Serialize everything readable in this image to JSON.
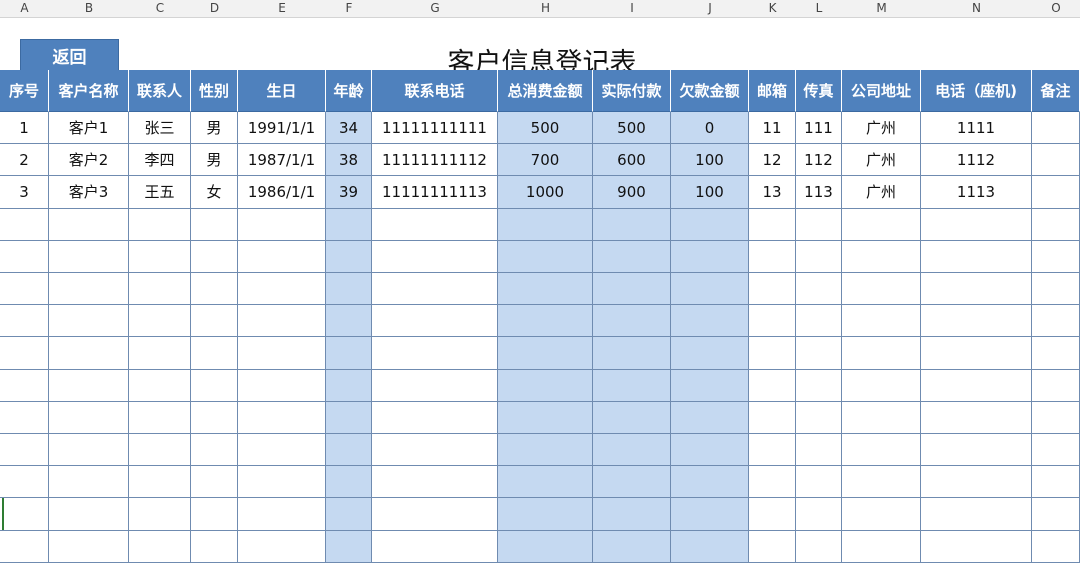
{
  "column_letters": [
    "A",
    "B",
    "C",
    "D",
    "E",
    "F",
    "G",
    "H",
    "I",
    "J",
    "K",
    "L",
    "M",
    "N",
    "O"
  ],
  "back_button": "返回",
  "title": "客户信息登记表",
  "headers": [
    "序号",
    "客户名称",
    "联系人",
    "性别",
    "生日",
    "年龄",
    "联系电话",
    "总消费金额",
    "实际付款",
    "欠款金额",
    "邮箱",
    "传真",
    "公司地址",
    "电话（座机)",
    "备注"
  ],
  "rows": [
    [
      "1",
      "客户1",
      "张三",
      "男",
      "1991/1/1",
      "34",
      "11111111111",
      "500",
      "500",
      "0",
      "11",
      "111",
      "广州",
      "1111",
      ""
    ],
    [
      "2",
      "客户2",
      "李四",
      "男",
      "1987/1/1",
      "38",
      "11111111112",
      "700",
      "600",
      "100",
      "12",
      "112",
      "广州",
      "1112",
      ""
    ],
    [
      "3",
      "客户3",
      "王五",
      "女",
      "1986/1/1",
      "39",
      "11111111113",
      "1000",
      "900",
      "100",
      "13",
      "113",
      "广州",
      "1113",
      ""
    ]
  ],
  "empty_rows": 11,
  "highlight_columns": [
    "F",
    "H",
    "I",
    "J"
  ],
  "colors": {
    "header_bg": "#4f81bd",
    "highlight": "#c5d9f1",
    "grid": "#6f8bb0"
  }
}
